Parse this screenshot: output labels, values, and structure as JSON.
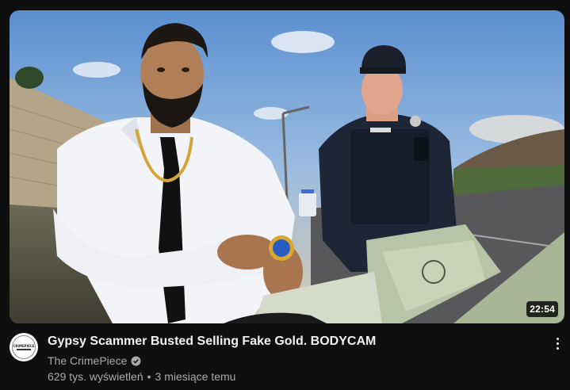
{
  "video": {
    "title": "Gypsy Scammer Busted Selling Fake Gold. BODYCAM",
    "duration": "22:54",
    "channel": "The CrimePiece",
    "views": "629 tys. wyświetleń",
    "separator": "•",
    "age": "3 miesiące temu",
    "verified_icon": "verified-check-icon",
    "menu_icon": "more-vert-icon"
  },
  "avatar": {
    "logo_text": "CRIMEPIECE"
  },
  "colors": {
    "background": "#0f0f0f",
    "title": "#f1f1f1",
    "secondary": "#aaaaaa",
    "duration_bg": "#000000cc"
  }
}
